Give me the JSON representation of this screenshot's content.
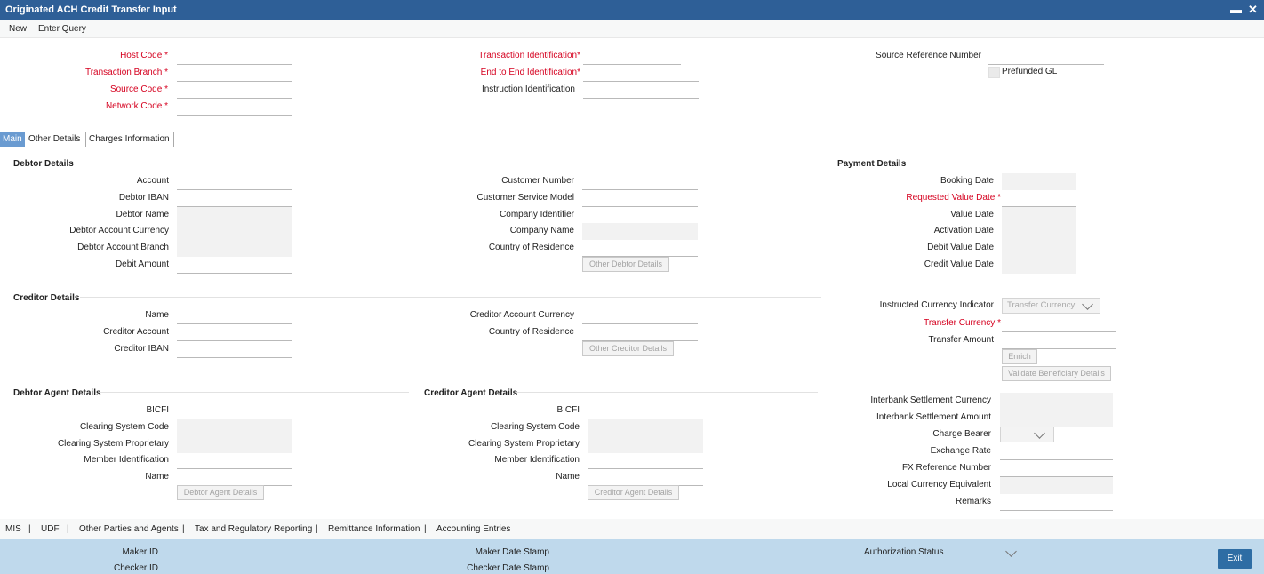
{
  "window": {
    "title": "Originated ACH Credit Transfer Input",
    "minimize": "▬",
    "close": "✕"
  },
  "menu": {
    "new": "New",
    "enter_query": "Enter Query"
  },
  "header": {
    "host_code": "Host Code",
    "transaction_branch": "Transaction Branch",
    "source_code": "Source Code",
    "network_code": "Network Code",
    "transaction_identification": "Transaction Identification",
    "end_to_end_identification": "End to End Identification",
    "instruction_identification": "Instruction Identification",
    "source_reference_number": "Source Reference Number",
    "prefunded_gl": "Prefunded GL",
    "required_mark": "*"
  },
  "tabs": {
    "main": "Main",
    "other_details": "Other Details",
    "charges_information": "Charges Information"
  },
  "debtor": {
    "title": "Debtor Details",
    "account": "Account",
    "debtor_iban": "Debtor IBAN",
    "debtor_name": "Debtor Name",
    "debtor_account_currency": "Debtor Account Currency",
    "debtor_account_branch": "Debtor Account Branch",
    "debit_amount": "Debit Amount",
    "customer_number": "Customer Number",
    "customer_service_model": "Customer Service Model",
    "company_identifier": "Company Identifier",
    "company_name": "Company Name",
    "country_of_residence": "Country of Residence",
    "other_debtor_details": "Other Debtor Details"
  },
  "payment": {
    "title": "Payment Details",
    "booking_date": "Booking Date",
    "requested_value_date": "Requested Value Date",
    "value_date": "Value Date",
    "activation_date": "Activation Date",
    "debit_value_date": "Debit Value Date",
    "credit_value_date": "Credit Value Date",
    "instructed_currency_indicator": "Instructed Currency Indicator",
    "instructed_currency_value": "Transfer Currency",
    "transfer_currency": "Transfer Currency",
    "transfer_amount": "Transfer Amount",
    "enrich": "Enrich",
    "validate_beneficiary": "Validate Beneficiary Details",
    "interbank_settlement_currency": "Interbank Settlement Currency",
    "interbank_settlement_amount": "Interbank Settlement Amount",
    "charge_bearer": "Charge Bearer",
    "exchange_rate": "Exchange Rate",
    "fx_reference_number": "FX Reference Number",
    "local_currency_equivalent": "Local Currency Equivalent",
    "remarks": "Remarks"
  },
  "creditor": {
    "title": "Creditor Details",
    "name": "Name",
    "creditor_account": "Creditor Account",
    "creditor_iban": "Creditor IBAN",
    "creditor_account_currency": "Creditor Account Currency",
    "country_of_residence": "Country of Residence",
    "other_creditor_details": "Other Creditor Details"
  },
  "debtor_agent": {
    "title": "Debtor Agent Details",
    "bicfi": "BICFI",
    "clearing_system_code": "Clearing System Code",
    "clearing_system_proprietary": "Clearing System Proprietary",
    "member_identification": "Member Identification",
    "name": "Name",
    "button": "Debtor Agent Details"
  },
  "creditor_agent": {
    "title": "Creditor Agent Details",
    "bicfi": "BICFI",
    "clearing_system_code": "Clearing System Code",
    "clearing_system_proprietary": "Clearing System Proprietary",
    "member_identification": "Member Identification",
    "name": "Name",
    "button": "Creditor Agent Details"
  },
  "bottom_tabs": {
    "mis": "MIS",
    "udf": "UDF",
    "other_parties": "Other Parties and Agents",
    "tax": "Tax and Regulatory Reporting",
    "remittance": "Remittance Information",
    "accounting": "Accounting Entries",
    "separator": "|"
  },
  "footer": {
    "maker_id": "Maker ID",
    "checker_id": "Checker ID",
    "maker_date_stamp": "Maker Date Stamp",
    "checker_date_stamp": "Checker Date Stamp",
    "authorization_status": "Authorization Status",
    "exit": "Exit"
  },
  "colors": {
    "title_bar": "#2e5f97",
    "required": "#d5001f",
    "footer": "#bfd9ec",
    "exit_button": "#2e6da4",
    "active_tab": "#6a9bd1"
  }
}
